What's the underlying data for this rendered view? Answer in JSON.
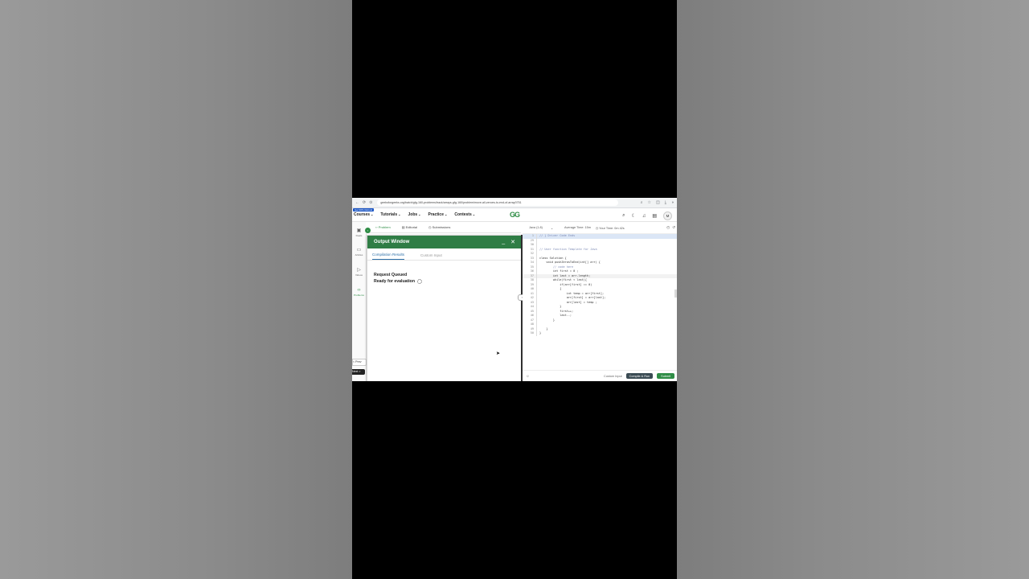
{
  "browser": {
    "url": "geeksforgeeks.org/batch/gfg-160-problems/track/arrays-gfg-160/problem/move-all-zeroes-to-end-of-array0751"
  },
  "site": {
    "promo": "Get 90% Refund",
    "nav": [
      "Courses",
      "Tutorials",
      "Jobs",
      "Practice",
      "Contests"
    ],
    "logo": "GG",
    "avatar": "M"
  },
  "rail": {
    "items": [
      {
        "label": "Deals",
        "icon": "bookmark-icon"
      },
      {
        "label": "Articles",
        "icon": "article-icon"
      },
      {
        "label": "Videos",
        "icon": "video-icon"
      },
      {
        "label": "Problems",
        "icon": "code-icon"
      }
    ],
    "prev": "< Prev",
    "next": "Next >"
  },
  "problem_tabs": [
    "Problem",
    "Editorial",
    "Submissions"
  ],
  "output_window": {
    "title": "Output Window",
    "tabs": [
      "Compilation Results",
      "Custom Input"
    ],
    "status_1": "Request Queued",
    "status_2": "Ready for evaluation"
  },
  "editor": {
    "language": "Java (1.8)",
    "avg_time": "Average Time: 15m",
    "your_time": "Your Time: 0m 42s",
    "lines": [
      {
        "n": "1",
        "t": "// } Driver Code Ends"
      },
      {
        "n": "29",
        "t": ""
      },
      {
        "n": "30",
        "t": ""
      },
      {
        "n": "31",
        "t": "// User function Template for Java"
      },
      {
        "n": "32",
        "t": ""
      },
      {
        "n": "33",
        "t": "class Solution {"
      },
      {
        "n": "34",
        "t": "    void pushZerosToEnd(int[] arr) {"
      },
      {
        "n": "35",
        "t": "        // code here"
      },
      {
        "n": "36",
        "t": "        int first = 0 ;"
      },
      {
        "n": "37",
        "t": "        int last = arr.length;"
      },
      {
        "n": "38",
        "t": "        while(first < last){"
      },
      {
        "n": "39",
        "t": "            if(arr[first] == 0)"
      },
      {
        "n": "40",
        "t": "            {"
      },
      {
        "n": "41",
        "t": "                int temp = arr[first];"
      },
      {
        "n": "42",
        "t": "                arr[first] = arr[last];"
      },
      {
        "n": "43",
        "t": "                arr[last] = temp ;"
      },
      {
        "n": "44",
        "t": "            }"
      },
      {
        "n": "45",
        "t": "            first++;"
      },
      {
        "n": "46",
        "t": "            last--;"
      },
      {
        "n": "47",
        "t": "        }"
      },
      {
        "n": "48",
        "t": ""
      },
      {
        "n": "49",
        "t": "    }"
      },
      {
        "n": "50",
        "t": "}"
      }
    ],
    "custom_input": "Custom Input",
    "compile_run": "Compile & Run",
    "submit": "Submit"
  },
  "colors": {
    "brand_green": "#2f8d46",
    "output_header": "#2f7d45"
  }
}
